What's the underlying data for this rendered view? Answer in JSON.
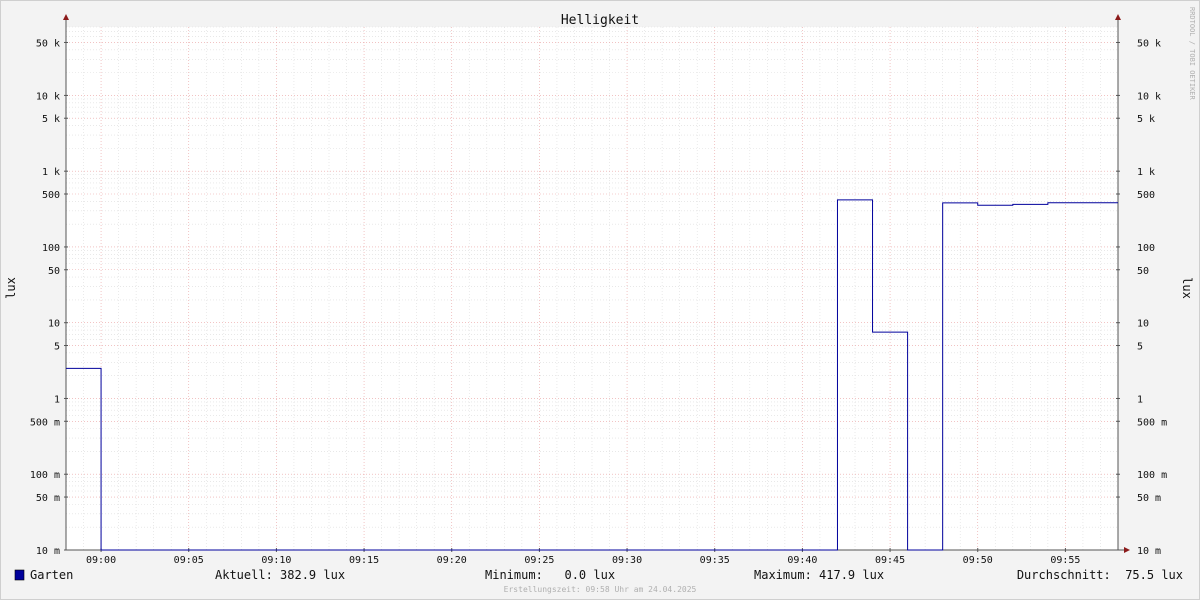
{
  "chart_data": {
    "type": "line",
    "title": "Helligkeit",
    "ylabel": "lux",
    "watermark": "RRDTOOL / TOBI OETIKER",
    "y_scale": "log",
    "ylim": [
      0.01,
      80000
    ],
    "xlim": [
      "08:58",
      "09:58"
    ],
    "x_ticks": [
      "09:00",
      "09:05",
      "09:10",
      "09:15",
      "09:20",
      "09:25",
      "09:30",
      "09:35",
      "09:40",
      "09:45",
      "09:50",
      "09:55"
    ],
    "y_ticks": [
      {
        "value": 50000,
        "label": "50 k"
      },
      {
        "value": 10000,
        "label": "10 k"
      },
      {
        "value": 5000,
        "label": "5 k"
      },
      {
        "value": 1000,
        "label": "1 k"
      },
      {
        "value": 500,
        "label": "500"
      },
      {
        "value": 100,
        "label": "100"
      },
      {
        "value": 50,
        "label": "50"
      },
      {
        "value": 10,
        "label": "10"
      },
      {
        "value": 5,
        "label": "5"
      },
      {
        "value": 1,
        "label": "1"
      },
      {
        "value": 0.5,
        "label": "500 m"
      },
      {
        "value": 0.1,
        "label": "100 m"
      },
      {
        "value": 0.05,
        "label": "50 m"
      },
      {
        "value": 0.01,
        "label": "10 m"
      }
    ],
    "grid": true,
    "series": [
      {
        "name": "Garten",
        "color": "#00009c",
        "step": true,
        "points": [
          {
            "x": "08:58",
            "y": 2.5
          },
          {
            "x": "09:00",
            "y": 0
          },
          {
            "x": "09:42",
            "y": 417.9
          },
          {
            "x": "09:44",
            "y": 7.5
          },
          {
            "x": "09:46",
            "y": 0
          },
          {
            "x": "09:48",
            "y": 382
          },
          {
            "x": "09:50",
            "y": 355
          },
          {
            "x": "09:52",
            "y": 365
          },
          {
            "x": "09:54",
            "y": 382.9
          },
          {
            "x": "09:58",
            "y": 382.9
          }
        ]
      }
    ]
  },
  "legend": {
    "series_name": "Garten",
    "series_color": "#00009c",
    "current": "Aktuell: 382.9 lux",
    "minimum": "Minimum:   0.0 lux",
    "maximum": "Maximum: 417.9 lux",
    "average": "Durchschnitt:  75.5 lux"
  },
  "footer": "Erstellungszeit: 09:58 Uhr am 24.04.2025"
}
